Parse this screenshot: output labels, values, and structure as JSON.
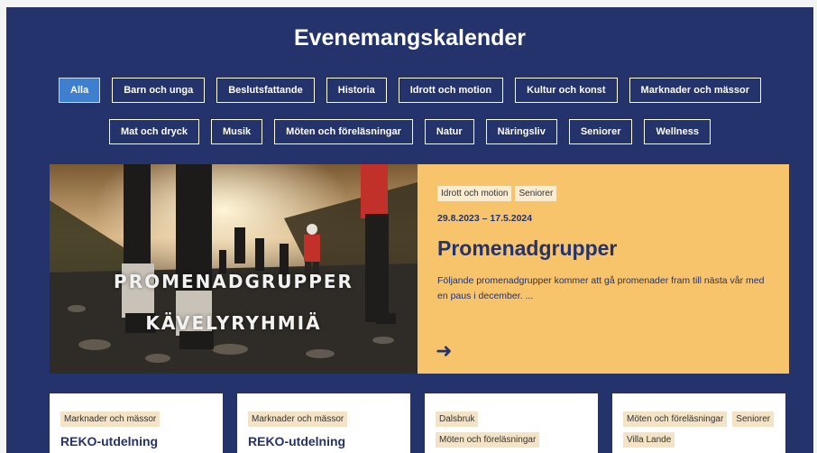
{
  "header": {
    "title": "Evenemangskalender"
  },
  "filters": {
    "row1": [
      "Alla",
      "Barn och unga",
      "Beslutsfattande",
      "Historia",
      "Idrott och motion",
      "Kultur och konst",
      "Marknader och mässor"
    ],
    "row2": [
      "Mat och dryck",
      "Musik",
      "Möten och föreläsningar",
      "Natur",
      "Näringsliv",
      "Seniorer",
      "Wellness"
    ],
    "active": "Alla"
  },
  "featured": {
    "image_text_1": "PROMENADGRUPPER",
    "image_text_2": "KÄVELYRYHMIÄ",
    "tags": [
      "Idrott och motion",
      "Seniorer"
    ],
    "date": "29.8.2023 – 17.5.2024",
    "title": "Promenadgrupper",
    "description": "Följande promenadgrupper kommer att gå promenader fram till nästa vår med en paus i december. ...",
    "arrow_icon": "arrow-right-icon",
    "arrow": "➜"
  },
  "cards": [
    {
      "tags": [
        "Marknader och mässor"
      ],
      "title": "REKO-utdelning"
    },
    {
      "tags": [
        "Marknader och mässor"
      ],
      "title": "REKO-utdelning"
    },
    {
      "tags": [
        "Dalsbruk",
        "Möten och föreläsningar"
      ],
      "title": ""
    },
    {
      "tags": [
        "Möten och föreläsningar",
        "Seniorer",
        "Villa Lande"
      ],
      "title": ""
    }
  ],
  "colors": {
    "background": "#24336b",
    "active_filter": "#3f7fd0",
    "featured_panel": "#f7c36b",
    "tag_background": "#fbecd0",
    "text_dark": "#24336b"
  }
}
